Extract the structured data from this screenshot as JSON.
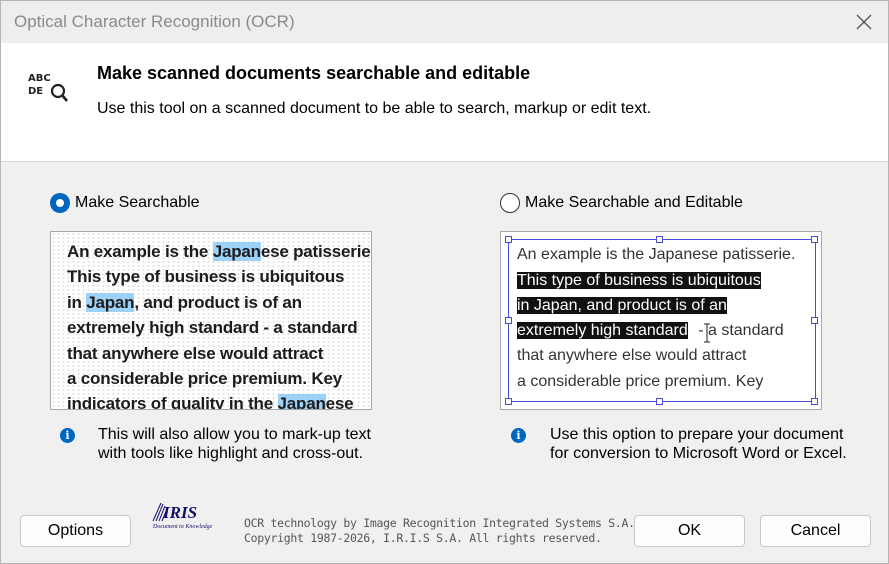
{
  "window": {
    "title": "Optical Character Recognition (OCR)"
  },
  "header": {
    "icon_text_top": "ABC",
    "icon_text_bottom": "DE",
    "title": "Make scanned documents searchable and editable",
    "subtitle": "Use this tool on a scanned document to be able to search, markup or edit text."
  },
  "options": {
    "searchable": {
      "label": "Make Searchable",
      "selected": true,
      "preview": {
        "l1a": "An example is the ",
        "l1b": "Japan",
        "l1c": "ese patisserie.",
        "l2": "This type of business is ubiquitous",
        "l3a": "in ",
        "l3b": "Japan",
        "l3c": ", and product is of an",
        "l4": "extremely high standard - a standard",
        "l5": "that anywhere else would attract",
        "l6": "a considerable price premium. Key",
        "l7a": "indicators of quality in the ",
        "l7b": "Japan",
        "l7c": "ese"
      },
      "note": "This will also allow you to mark-up text\nwith tools like highlight and cross-out."
    },
    "editable": {
      "label": "Make Searchable and Editable",
      "selected": false,
      "preview": {
        "l1": "An example is the Japanese patisserie.",
        "l2": "This type of business is ubiquitous",
        "l3": "in Japan, and product is of an",
        "l4a": "extremely high standard",
        "l4b": " - a standard",
        "l5": "that anywhere else would attract",
        "l6": "a considerable price premium. Key"
      },
      "note": "Use this option to prepare your document\nfor conversion to Microsoft Word or Excel."
    }
  },
  "footer": {
    "options_button": "Options",
    "logo_text": "IRIS",
    "logo_tagline": "Document to Knowledge",
    "copyright_line1": "OCR technology by Image Recognition Integrated Systems S.A.",
    "copyright_line2": "Copyright 1987-2026, I.R.I.S S.A. All rights reserved.",
    "ok_button": "OK",
    "cancel_button": "Cancel"
  },
  "colors": {
    "accent": "#0067c0",
    "highlight": "#9ed1f8",
    "selection_frame": "#4b4bd6"
  },
  "icons": {
    "close": "close-icon",
    "ocr": "ocr-search-icon",
    "info": "info-icon"
  }
}
